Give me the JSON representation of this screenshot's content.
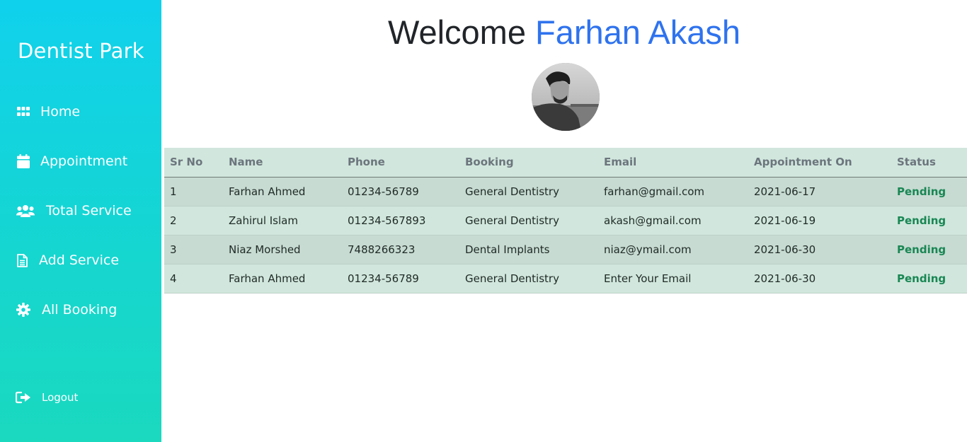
{
  "sidebar": {
    "brand": "Dentist Park",
    "items": [
      {
        "label": "Home",
        "icon": "grid-icon"
      },
      {
        "label": "Appointment",
        "icon": "calendar-icon"
      },
      {
        "label": "Total Service",
        "icon": "users-icon"
      },
      {
        "label": "Add Service",
        "icon": "file-icon"
      },
      {
        "label": "All Booking",
        "icon": "gear-icon"
      }
    ],
    "logout": {
      "label": "Logout",
      "icon": "logout-icon"
    }
  },
  "main": {
    "welcome_prefix": "Welcome",
    "user_name": "Farhan Akash"
  },
  "table": {
    "headers": [
      "Sr No",
      "Name",
      "Phone",
      "Booking",
      "Email",
      "Appointment On",
      "Status"
    ],
    "rows": [
      {
        "sr": "1",
        "name": "Farhan Ahmed",
        "phone": "01234-56789",
        "booking": "General Dentistry",
        "email": "farhan@gmail.com",
        "date": "2021-06-17",
        "status": "Pending"
      },
      {
        "sr": "2",
        "name": "Zahirul Islam",
        "phone": "01234-567893",
        "booking": "General Dentistry",
        "email": "akash@gmail.com",
        "date": "2021-06-19",
        "status": "Pending"
      },
      {
        "sr": "3",
        "name": "Niaz Morshed",
        "phone": "7488266323",
        "booking": "Dental Implants",
        "email": "niaz@ymail.com",
        "date": "2021-06-30",
        "status": "Pending"
      },
      {
        "sr": "4",
        "name": "Farhan Ahmed",
        "phone": "01234-56789",
        "booking": "General Dentistry",
        "email": "Enter Your Email",
        "date": "2021-06-30",
        "status": "Pending"
      }
    ]
  },
  "colors": {
    "accent_blue": "#2f73ee",
    "sidebar_top": "#10d1ec",
    "sidebar_bottom": "#1ad9bf",
    "table_bg": "#d1e7dd",
    "status_green": "#198754"
  }
}
